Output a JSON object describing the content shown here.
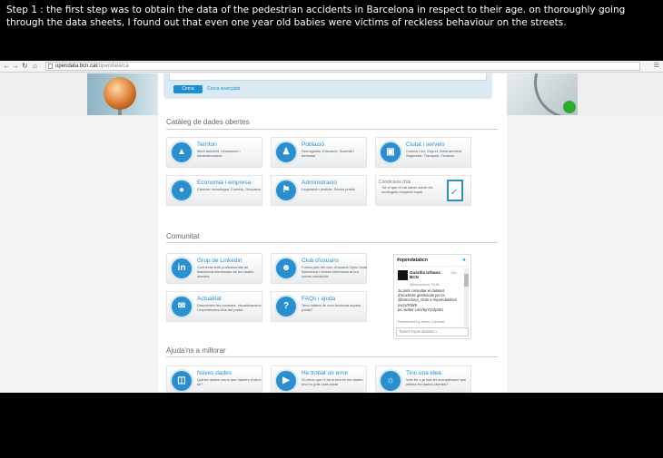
{
  "caption": "Step 1 : the first step was to obtain the data of the pedestrian accidents in Barcelona in respect to their age. on thoroughly going through the data sheets, I found out that even one year old babies were  victims of reckless behaviour on the streets.",
  "browser": {
    "url": "opendata.bcn.cat/opendata/ca",
    "url_host": "opendata.bcn.cat",
    "url_path": "/opendata/ca",
    "back_icon": "back-arrow-icon",
    "forward_icon": "forward-arrow-icon",
    "reload_icon": "reload-icon",
    "home_icon": "home-icon"
  },
  "search": {
    "button_label": "Cerca",
    "advanced_link": "Cerca avançada"
  },
  "catalog": {
    "title": "Catàleg de dades obertes",
    "tiles": [
      {
        "title": "Territori",
        "desc": "Medi ambient, Urbanisme i infraestructures",
        "icon": "map-icon"
      },
      {
        "title": "Població",
        "desc": "Demografia, Educació, Societat i benestar",
        "icon": "people-icon"
      },
      {
        "title": "Ciutat i serveis",
        "desc": "Cultura i oci, Esport, Medi ambient, Seguretat, Transport, Turisme",
        "icon": "car-icon"
      },
      {
        "title": "Economia i empresa",
        "desc": "Ciència i tecnologia, Comerç, Ocupació",
        "icon": "coins-icon"
      },
      {
        "title": "Administració",
        "desc": "Legislació i justícia, Sector públic",
        "icon": "building-icon"
      }
    ],
    "doc_tile": {
      "title": "Condicions d'ús",
      "desc": "Tot el que et cal saber sobre els continguts d'aquest espai"
    }
  },
  "community": {
    "title": "Comunitat",
    "tiles": [
      {
        "title": "Grup de Linkedin",
        "desc": "Connecta amb professionals de Barcelona interessats en les dades obertes",
        "icon": "linkedin-icon"
      },
      {
        "title": "Club d'usuaris",
        "desc": "Forma part del club d'usuaris Open Data Barcelona i rebràs informació al teu correu electrònic",
        "icon": "users-icon"
      },
      {
        "title": "Actualitat",
        "desc": "Descobreix les novetats, visualitzacions i experiències d'ús del portal",
        "icon": "chat-icon"
      },
      {
        "title": "FAQs i ajuda",
        "desc": "Tens dubtes de com funciona aquest portal?",
        "icon": "question-icon"
      }
    ]
  },
  "twitter": {
    "header": "#opendatabcn",
    "name": "Guàrdia Urbana BCN",
    "follow": "Follow",
    "handle": "@barcelona_GUB",
    "date": "13h",
    "text": "Ja pots consultar el dataset d'incidents gestionats per la @barcelona_GUB a #opendatabcn ow.ly/RtW9 pic.twitter.com/8yYtA2pr8U",
    "retweeted": "Retweeted by Alecs Colubrat",
    "tweet_placeholder": "Tweet #opendatabcn"
  },
  "help": {
    "title": "Ajuda'ns a millorar",
    "tiles": [
      {
        "title": "Noves dades",
        "desc": "Quines dades creus que haurien d'obrir-se?",
        "icon": "monitor-icon"
      },
      {
        "title": "He trobat un error",
        "desc": "Si creus que hi ha errors en les dades ens ho pots comunicar",
        "icon": "megaphone-icon"
      },
      {
        "title": "Tinc una idea",
        "desc": "Vols fer o ja has fet una aplicació que utilitza les dades obertes?",
        "icon": "lightbulb-icon"
      }
    ]
  },
  "colors": {
    "accent": "#2a8fcf",
    "button": "#1b8fd1"
  }
}
